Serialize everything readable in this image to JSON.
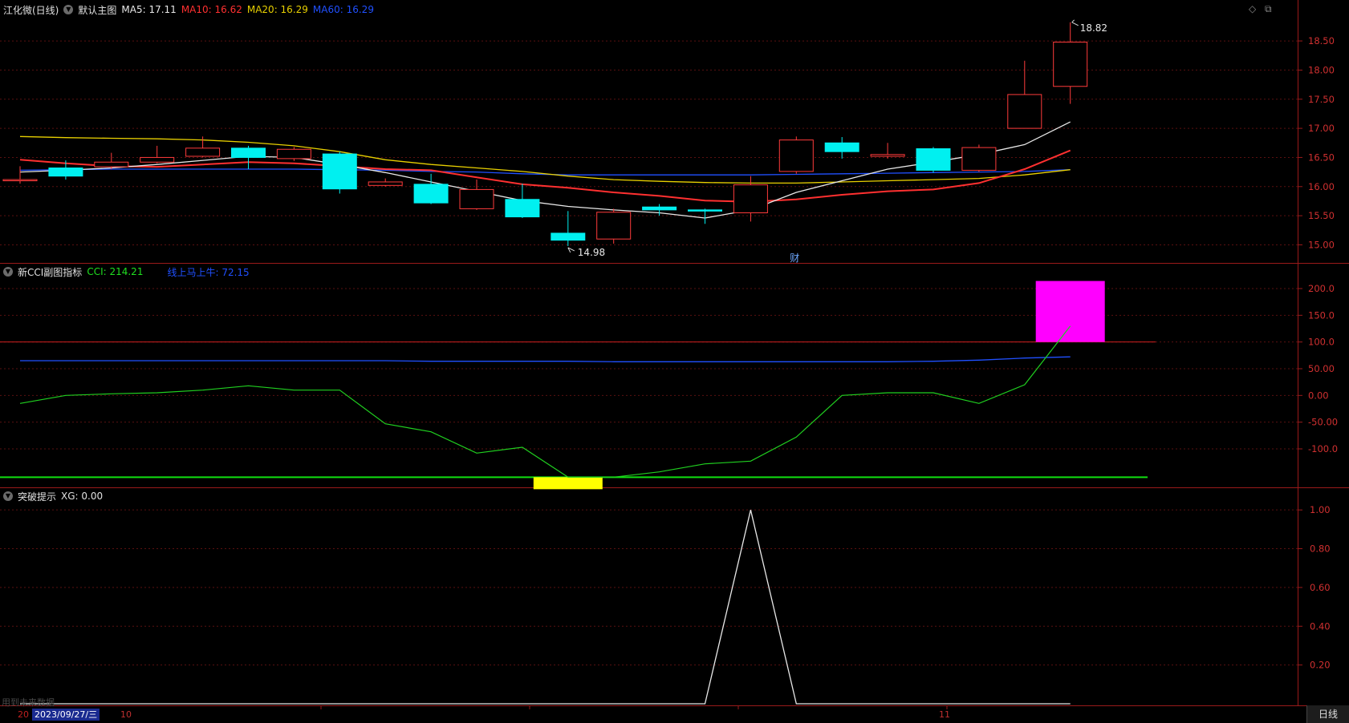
{
  "main_panel": {
    "stock_name": "江化微(日线)",
    "template_name": "默认主图",
    "ma_labels": [
      {
        "text": "MA5: 17.11",
        "color": "#e8e8e8"
      },
      {
        "text": "MA10: 16.62",
        "color": "#ff3030"
      },
      {
        "text": "MA20: 16.29",
        "color": "#e8d000"
      },
      {
        "text": "MA60: 16.29",
        "color": "#2050ff"
      }
    ],
    "high_annotation": "18.82",
    "low_annotation": "14.98",
    "event_marker": "财",
    "y_axis_labels": [
      "18.50",
      "18.00",
      "17.50",
      "17.00",
      "16.50",
      "16.00",
      "15.50",
      "15.00"
    ]
  },
  "cci_panel": {
    "indicator_name": "新CCI副图指标",
    "cci_label": "CCI: 214.21",
    "cci_color": "#20e020",
    "second_label": "线上马上牛: 72.15",
    "second_color": "#2050ff",
    "y_axis_labels": [
      "200.0",
      "150.0",
      "100.0",
      "50.00",
      "0.00",
      "-50.00",
      "-100.0"
    ]
  },
  "breakout_panel": {
    "indicator_name": "突破提示",
    "xg_label": "XG: 0.00",
    "y_axis_labels": [
      "1.00",
      "0.80",
      "0.60",
      "0.40",
      "0.20"
    ]
  },
  "footer": {
    "note": "用到未来数据",
    "date_prefix": "20",
    "current_date": "2023/09/27/三",
    "month_labels": [
      "10",
      "11"
    ],
    "period_button": "日线"
  },
  "window_controls": {
    "diamond": "◇",
    "restore": "⧉"
  },
  "chart_data": [
    {
      "type": "candlestick",
      "title": "江化微(日线)",
      "ylim": [
        14.8,
        18.9
      ],
      "candles": [
        {
          "o": 16.12,
          "h": 16.35,
          "l": 16.05,
          "c": 16.12
        },
        {
          "o": 16.32,
          "h": 16.45,
          "l": 16.12,
          "c": 16.18
        },
        {
          "o": 16.34,
          "h": 16.58,
          "l": 16.3,
          "c": 16.42
        },
        {
          "o": 16.42,
          "h": 16.7,
          "l": 16.4,
          "c": 16.5
        },
        {
          "o": 16.52,
          "h": 16.86,
          "l": 16.5,
          "c": 16.66
        },
        {
          "o": 16.66,
          "h": 16.7,
          "l": 16.3,
          "c": 16.5
        },
        {
          "o": 16.48,
          "h": 16.68,
          "l": 16.44,
          "c": 16.64
        },
        {
          "o": 16.56,
          "h": 16.6,
          "l": 15.88,
          "c": 15.96
        },
        {
          "o": 16.02,
          "h": 16.14,
          "l": 16.0,
          "c": 16.08
        },
        {
          "o": 16.04,
          "h": 16.22,
          "l": 15.7,
          "c": 15.72
        },
        {
          "o": 15.62,
          "h": 16.12,
          "l": 15.6,
          "c": 15.95
        },
        {
          "o": 15.78,
          "h": 16.05,
          "l": 15.46,
          "c": 15.48
        },
        {
          "o": 15.2,
          "h": 15.58,
          "l": 14.98,
          "c": 15.08
        },
        {
          "o": 15.1,
          "h": 15.62,
          "l": 15.02,
          "c": 15.56
        },
        {
          "o": 15.65,
          "h": 15.7,
          "l": 15.5,
          "c": 15.6
        },
        {
          "o": 15.6,
          "h": 15.62,
          "l": 15.36,
          "c": 15.58
        },
        {
          "o": 15.55,
          "h": 16.18,
          "l": 15.4,
          "c": 16.03
        },
        {
          "o": 16.26,
          "h": 16.86,
          "l": 16.22,
          "c": 16.8
        },
        {
          "o": 16.75,
          "h": 16.85,
          "l": 16.48,
          "c": 16.6
        },
        {
          "o": 16.52,
          "h": 16.75,
          "l": 16.48,
          "c": 16.55
        },
        {
          "o": 16.65,
          "h": 16.68,
          "l": 16.24,
          "c": 16.28
        },
        {
          "o": 16.28,
          "h": 16.72,
          "l": 16.25,
          "c": 16.67
        },
        {
          "o": 17.0,
          "h": 18.16,
          "l": 17.0,
          "c": 17.58
        },
        {
          "o": 17.72,
          "h": 18.82,
          "l": 17.42,
          "c": 18.48
        }
      ],
      "ma5": [
        16.25,
        16.28,
        16.32,
        16.38,
        16.45,
        16.52,
        16.5,
        16.38,
        16.24,
        16.08,
        15.92,
        15.76,
        15.66,
        15.6,
        15.55,
        15.46,
        15.6,
        15.9,
        16.1,
        16.3,
        16.42,
        16.55,
        16.72,
        17.11
      ],
      "ma10": [
        16.46,
        16.4,
        16.35,
        16.34,
        16.38,
        16.42,
        16.4,
        16.35,
        16.3,
        16.28,
        16.16,
        16.04,
        15.98,
        15.9,
        15.84,
        15.76,
        15.74,
        15.78,
        15.86,
        15.92,
        15.95,
        16.06,
        16.3,
        16.62
      ],
      "ma20": [
        16.86,
        16.84,
        16.83,
        16.82,
        16.8,
        16.76,
        16.7,
        16.6,
        16.46,
        16.38,
        16.32,
        16.26,
        16.18,
        16.12,
        16.09,
        16.07,
        16.06,
        16.06,
        16.08,
        16.1,
        16.12,
        16.14,
        16.2,
        16.29
      ],
      "ma60": [
        16.28,
        16.29,
        16.3,
        16.3,
        16.3,
        16.3,
        16.3,
        16.29,
        16.28,
        16.26,
        16.25,
        16.22,
        16.2,
        16.2,
        16.2,
        16.2,
        16.2,
        16.21,
        16.22,
        16.23,
        16.24,
        16.25,
        16.26,
        16.29
      ]
    },
    {
      "type": "line",
      "title": "新CCI副图指标",
      "ylim": [
        -160,
        230
      ],
      "series": [
        {
          "name": "CCI",
          "values": [
            -15,
            0,
            3,
            5,
            10,
            18,
            10,
            10,
            -53,
            -68,
            -108,
            -97,
            -153,
            -153,
            -143,
            -128,
            -123,
            -78,
            0,
            5,
            5,
            -15,
            20,
            214.21
          ]
        },
        {
          "name": "线上马上牛",
          "values": [
            65,
            65,
            65,
            65,
            65,
            65,
            65,
            65,
            65,
            64,
            64,
            64,
            64,
            63,
            63,
            63,
            63,
            63,
            63,
            63,
            64,
            66,
            70,
            72.15
          ]
        }
      ]
    },
    {
      "type": "line",
      "title": "突破提示",
      "ylim": [
        0,
        1.1
      ],
      "series": [
        {
          "name": "XG",
          "values": [
            0,
            0,
            0,
            0,
            0,
            0,
            0,
            0,
            0,
            0,
            0,
            0,
            0,
            0,
            0,
            0,
            1,
            0,
            0,
            0,
            0,
            0,
            0,
            0
          ]
        }
      ]
    }
  ]
}
